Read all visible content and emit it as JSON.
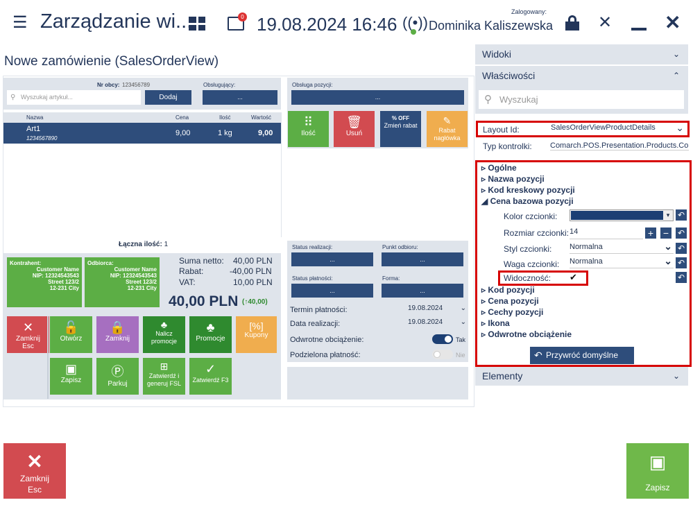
{
  "header": {
    "title": "Zarządzanie wi...",
    "notification_count": "0",
    "datetime": "19.08.2024 16:46",
    "logged_label": "Zalogowany:",
    "user": "Dominika Kaliszewska"
  },
  "page_title": "Nowe zamówienie (SalesOrderView)",
  "search": {
    "placeholder": "Wyszukaj artykuł...",
    "add_label": "Dodaj",
    "foreign_no_label": "Nr obcy:",
    "foreign_no_value": "123456789",
    "served_label": "Obsługujący:",
    "served_value": "..."
  },
  "items_table": {
    "headers": [
      "Nazwa",
      "Cena",
      "Ilość",
      "Wartość"
    ],
    "rows": [
      {
        "name": "Art1",
        "code": "1234567890",
        "price": "9,00",
        "qty": "1 kg",
        "value": "9,00"
      }
    ]
  },
  "position_handling": {
    "label": "Obsługa pozycji:",
    "value": "...",
    "tiles": [
      {
        "label": "Ilość",
        "color": "#5cae45"
      },
      {
        "label": "Usuń",
        "color": "#d24b50"
      },
      {
        "label": "Zmień rabat",
        "color": "#2e4d7b",
        "badge": "% OFF"
      },
      {
        "label": "Rabat nagłówka",
        "color": "#f0ad4e"
      }
    ]
  },
  "total_qty": {
    "label": "Łączna ilość:",
    "value": "1"
  },
  "contractor": {
    "label": "Kontrahent:",
    "name": "Customer Name",
    "nip": "NIP: 12324543543",
    "street": "Street 123/2",
    "city": "12-231 City"
  },
  "recipient": {
    "label": "Odbiorca:",
    "name": "Customer Name",
    "nip": "NIP: 12324543543",
    "street": "Street 123/2",
    "city": "12-231 City"
  },
  "summary": {
    "net_label": "Suma netto:",
    "net": "40,00 PLN",
    "discount_label": "Rabat:",
    "discount": "-40,00 PLN",
    "vat_label": "VAT:",
    "vat": "10,00 PLN",
    "total": "40,00 PLN",
    "change": "(↑40,00)"
  },
  "actions": [
    {
      "label": "Zamknij\nEsc",
      "color": "#d24b50"
    },
    {
      "label": "Otwórz",
      "color": "#5cae45"
    },
    {
      "label": "Zamknij",
      "color": "#a66fc0"
    },
    {
      "label": "Nalicz promocje",
      "color": "#2f8a2f"
    },
    {
      "label": "Promocje",
      "color": "#2f8a2f"
    },
    {
      "label": "Kupony",
      "color": "#f0ad4e"
    },
    {
      "label": "Zapisz",
      "color": "#5cae45"
    },
    {
      "label": "Parkuj",
      "color": "#5cae45"
    },
    {
      "label": "Zatwierdź i generuj FSL",
      "color": "#5cae45"
    },
    {
      "label": "Zatwierdź F3",
      "color": "#5cae45"
    }
  ],
  "status": {
    "realization_label": "Status realizacji:",
    "realization": "...",
    "pickup_label": "Punkt odbioru:",
    "pickup": "...",
    "payment_status_label": "Status płatności:",
    "payment_status": "...",
    "form_label": "Forma:",
    "form": "...",
    "payment_term_label": "Termin płatności:",
    "payment_term": "19.08.2024",
    "realization_date_label": "Data realizacji:",
    "realization_date": "19.08.2024",
    "reverse_label": "Odwrotne obciążenie:",
    "reverse_value": "Tak",
    "split_label": "Podzielona płatność:",
    "split_value": "Nie"
  },
  "right_panel": {
    "views": "Widoki",
    "properties": "Właściwości",
    "search_placeholder": "Wyszukaj",
    "layout_id_label": "Layout Id:",
    "layout_id_value": "SalesOrderViewProductDetails",
    "control_type_label": "Typ kontrolki:",
    "control_type_value": "Comarch.POS.Presentation.Products.Co",
    "tree_top": [
      "Ogólne",
      "Nazwa pozycji",
      "Kod kreskowy pozycji"
    ],
    "tree_open": "Cena bazowa pozycji",
    "font_color_label": "Kolor czcionki:",
    "font_color": "#1c3f74",
    "font_size_label": "Rozmiar czcionki:",
    "font_size": "14",
    "font_style_label": "Styl czcionki:",
    "font_style": "Normalna",
    "font_weight_label": "Waga czcionki:",
    "font_weight": "Normalna",
    "visibility_label": "Widoczność:",
    "tree_bottom": [
      "Kod pozycji",
      "Cena pozycji",
      "Cechy pozycji",
      "Ikona",
      "Odwrotne obciążenie"
    ],
    "restore_label": "Przywróć domyślne",
    "elements": "Elementy"
  },
  "footer": {
    "close_label": "Zamknij\nEsc",
    "save_label": "Zapisz"
  }
}
